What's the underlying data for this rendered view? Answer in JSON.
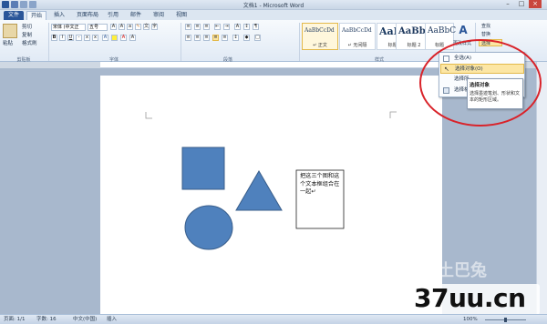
{
  "window": {
    "title": "文档1 - Microsoft Word"
  },
  "tabs": [
    "文件",
    "开始",
    "插入",
    "页面布局",
    "引用",
    "邮件",
    "审阅",
    "视图"
  ],
  "clipboard": {
    "paste": "粘贴",
    "cut": "剪切",
    "copy": "复制",
    "format_painter": "格式刷",
    "label": "剪贴板"
  },
  "font": {
    "name": "宋体 (中文正",
    "size": "五号",
    "label": "字体"
  },
  "paragraph": {
    "label": "段落"
  },
  "styles": {
    "items": [
      {
        "sample": "AaBbCcDd",
        "name": "↵ 正文"
      },
      {
        "sample": "AaBbCcDd",
        "name": "↵ 无间隔"
      },
      {
        "sample": "AaBb",
        "name": "标题 1"
      },
      {
        "sample": "AaBb(",
        "name": "标题 2"
      },
      {
        "sample": "AaBbC",
        "name": "标题"
      }
    ],
    "change": "更改样式",
    "label": "样式"
  },
  "editing": {
    "find": "查找",
    "replace": "替换",
    "select": "选择"
  },
  "menu": {
    "items": [
      "全选(A)",
      "选择对象(O)",
      "选择所",
      "选择格"
    ]
  },
  "tooltip": {
    "title": "选择对象",
    "desc": "选择墨迹笔划、形状和文本的矩形区域。"
  },
  "document": {
    "textbox": "把这三个图和这个文本框组合在一起↵"
  },
  "status": {
    "page": "页面: 1/1",
    "words": "字数: 16",
    "lang": "中文(中国)",
    "mode": "插入",
    "zoom": "100%"
  },
  "watermark": {
    "site": "37uu.cn",
    "brand": "土巴兔"
  },
  "colors": {
    "shape_fill": "#4f81bd",
    "shape_stroke": "#385d8a",
    "highlight_ring": "#d9232a"
  }
}
